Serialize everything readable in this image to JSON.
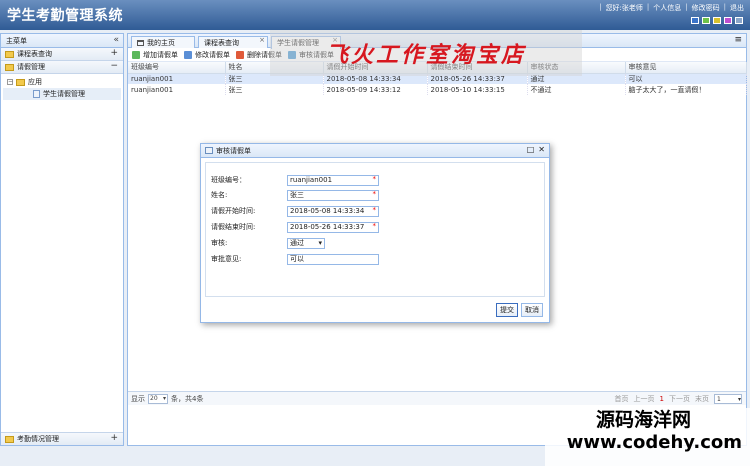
{
  "app": {
    "title": "学生考勤管理系统",
    "top_links": [
      "您好:张老师",
      "个人信息",
      "修改密码",
      "退出"
    ],
    "theme_colors": [
      "#3b74c9",
      "#6fc24a",
      "#d6c12f",
      "#c04fd1",
      "#8aa5c9"
    ]
  },
  "sidebar": {
    "header": "主菜单",
    "collapse_glyph": "«",
    "sections": [
      {
        "label": "课程表查询",
        "toggle": "+"
      },
      {
        "label": "请假管理",
        "toggle": "−"
      }
    ],
    "tree": {
      "folder_label": "应用",
      "folder_toggle": "−",
      "item_label": "学生请假管理"
    },
    "bottom_section": {
      "label": "考勤情况管理",
      "toggle": "+"
    }
  },
  "tabs": [
    {
      "label": "我的主页"
    },
    {
      "label": "课程表查询"
    },
    {
      "label": "学生请假管理"
    }
  ],
  "toolbar": {
    "add": "增加请假单",
    "edit": "修改请假单",
    "delete": "删除请假单",
    "review": "审核请假单"
  },
  "grid": {
    "columns": [
      "班级编号",
      "姓名",
      "请假开始时间",
      "请假结束时间",
      "审核状态",
      "审核意见"
    ],
    "rows": [
      [
        "ruanjian001",
        "张三",
        "2018-05-08 14:33:34",
        "2018-05-26 14:33:37",
        "通过",
        "可以"
      ],
      [
        "ruanjian001",
        "张三",
        "2018-05-09 14:33:12",
        "2018-05-10 14:33:15",
        "不通过",
        "脑子太大了，一直请假！"
      ]
    ]
  },
  "pager": {
    "show_label": "显示",
    "page_size": "20",
    "summary": "条，共4条",
    "first": "首页",
    "prev": "上一页",
    "current": "1",
    "next": "下一页",
    "last": "末页",
    "page_input": "1"
  },
  "dialog": {
    "title": "审核请假单",
    "fields": [
      {
        "label": "班级编号：",
        "value": "ruanjian001"
      },
      {
        "label": "姓名:",
        "value": "张三"
      },
      {
        "label": "请假开始时间:",
        "value": "2018-05-08 14:33:34"
      },
      {
        "label": "请假结束时间:",
        "value": "2018-05-26 14:33:37"
      }
    ],
    "review_label": "审核:",
    "review_value": "通过",
    "opinion_label": "审批意见:",
    "opinion_value": "可以",
    "submit": "提交",
    "cancel": "取消"
  },
  "watermarks": {
    "top": "飞火工作室淘宝店",
    "bottom_line1": "源码海洋网",
    "bottom_line2": "www.codehy.com"
  }
}
